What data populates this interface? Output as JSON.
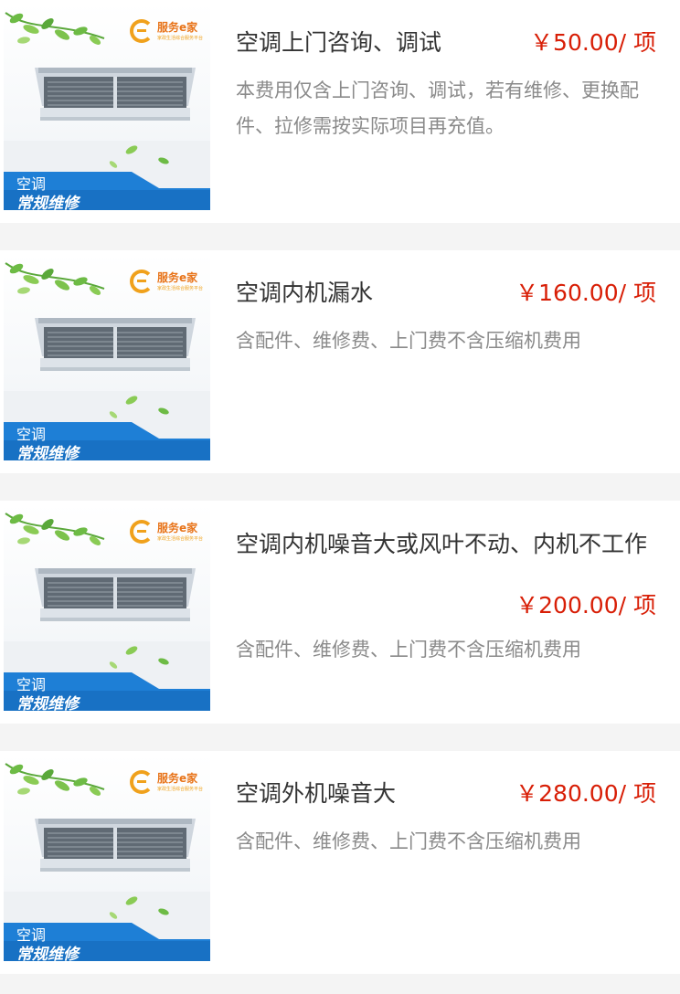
{
  "items": [
    {
      "title": "空调上门咨询、调试",
      "price": "￥50.00/ 项",
      "desc": "本费用仅含上门咨询、调试，若有维修、更换配件、拉修需按实际项目再充值。",
      "thumb": {
        "brand_name": "服务e家",
        "brand_sub": "家政生活综合服务平台",
        "banner_line1": "空调",
        "banner_line2": "常规维修"
      }
    },
    {
      "title": "空调内机漏水",
      "price": "￥160.00/ 项",
      "desc": "含配件、维修费、上门费不含压缩机费用",
      "thumb": {
        "brand_name": "服务e家",
        "brand_sub": "家政生活综合服务平台",
        "banner_line1": "空调",
        "banner_line2": "常规维修"
      }
    },
    {
      "title": "空调内机噪音大或风叶不动、内机不工作",
      "price": "￥200.00/ 项",
      "desc": "含配件、维修费、上门费不含压缩机费用",
      "thumb": {
        "brand_name": "服务e家",
        "brand_sub": "家政生活综合服务平台",
        "banner_line1": "空调",
        "banner_line2": "常规维修"
      }
    },
    {
      "title": "空调外机噪音大",
      "price": "￥280.00/ 项",
      "desc": "含配件、维修费、上门费不含压缩机费用",
      "thumb": {
        "brand_name": "服务e家",
        "brand_sub": "家政生活综合服务平台",
        "banner_line1": "空调",
        "banner_line2": "常规维修"
      }
    }
  ],
  "colors": {
    "price": "#d81e06",
    "title": "#333333",
    "desc": "#8a8a8a",
    "banner": "#1e7fd6",
    "brand": "#f0a11c",
    "separator": "#f4f4f4"
  }
}
